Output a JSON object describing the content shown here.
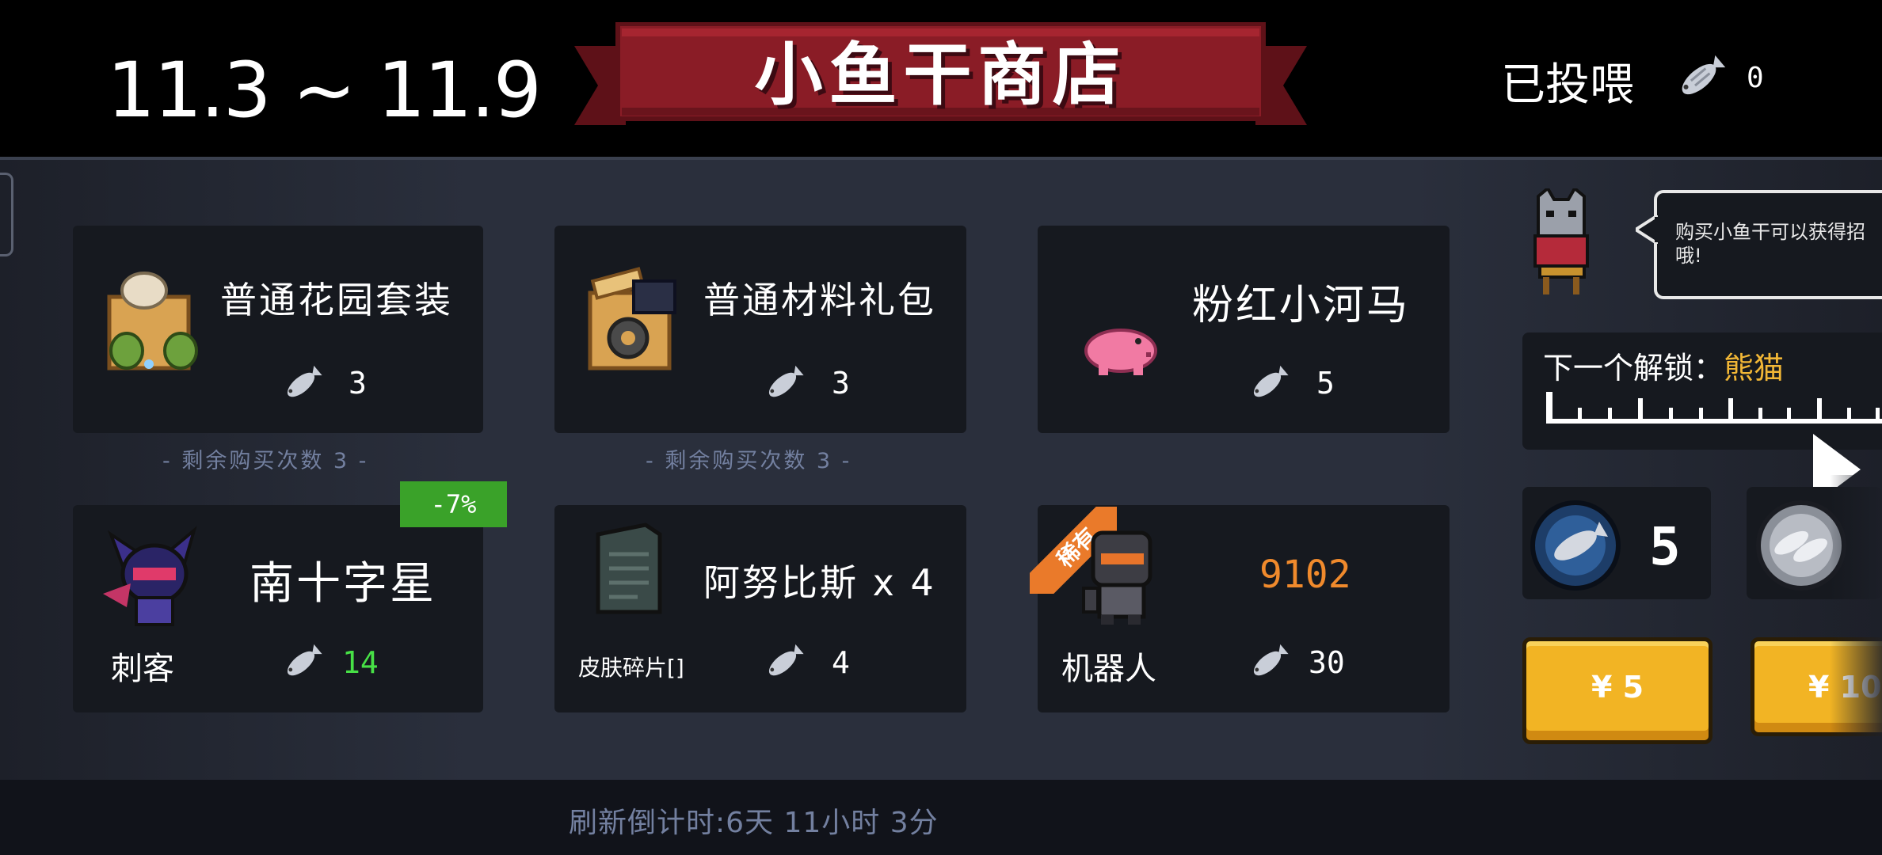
{
  "header": {
    "date_range": "11.3 ~ 11.9",
    "shop_title": "小鱼干商店",
    "fed_label": "已投喂",
    "fed_count": "0",
    "fed_icon": "dried-fish-icon"
  },
  "items": [
    {
      "name": "普通花园套装",
      "price": "3",
      "icon": "garden-set-icon",
      "remaining": "- 剩余购买次数 3 -"
    },
    {
      "name": "普通材料礼包",
      "price": "3",
      "icon": "material-pack-icon",
      "remaining": "- 剩余购买次数 3 -"
    },
    {
      "name": "粉红小河马",
      "price": "5",
      "icon": "pink-hippo-icon"
    },
    {
      "name": "南十字星",
      "sub": "刺客",
      "price": "14",
      "price_color": "#47e046",
      "icon": "assassin-skin-icon",
      "discount": "-7%"
    },
    {
      "name": "阿努比斯 x 4",
      "sub": "皮肤碎片[]",
      "price": "4",
      "icon": "skin-fragment-icon"
    },
    {
      "name": "9102",
      "sub": "机器人",
      "price": "30",
      "tag": "稀有",
      "name_color": "#f08a2c",
      "icon": "robot-skin-icon"
    }
  ],
  "sidebar": {
    "bubble_text": "购买小鱼干可以获得招哦!",
    "unlock_label": "下一个解锁：",
    "unlock_value": "熊猫",
    "slots": [
      {
        "qty": "5",
        "icon": "fish-bowl-icon"
      },
      {
        "qty": "",
        "icon": "fish-plate-icon"
      }
    ],
    "buttons": [
      {
        "label": "¥ 5"
      },
      {
        "label": "¥ 10"
      }
    ]
  },
  "footer": {
    "countdown": "刷新倒计时:6天 11小时 3分"
  },
  "colors": {
    "accent_orange": "#f08a2c",
    "discount_green": "#3aa229",
    "button_yellow": "#f2b424",
    "banner_red": "#8a1c26",
    "unlock_gold": "#f2b736"
  }
}
